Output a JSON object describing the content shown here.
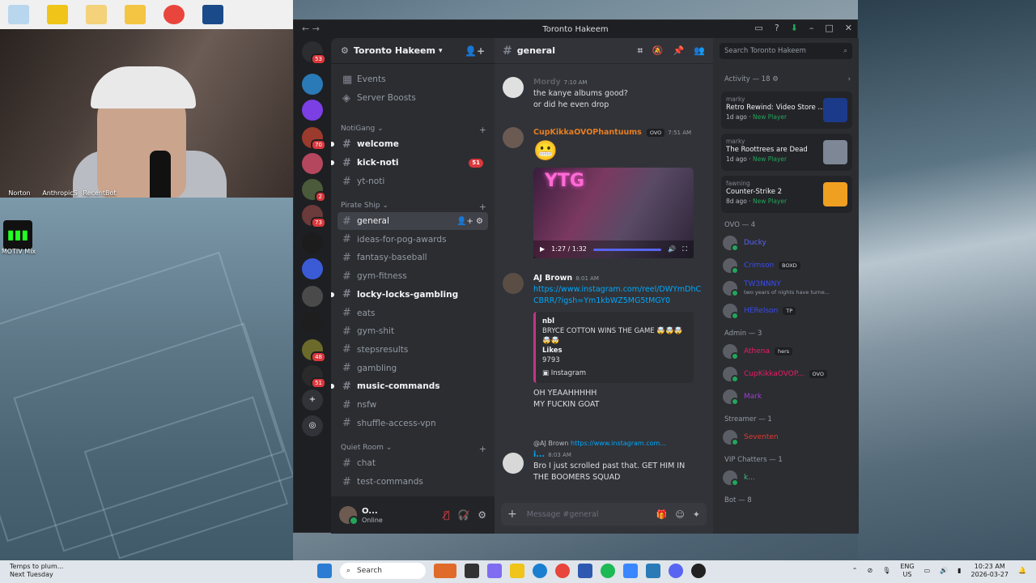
{
  "desktop": {
    "icon_labels": [
      "Norton AntiVirus",
      "AnthropicS",
      "RecentBot Desktop",
      "MOTIV Mix"
    ]
  },
  "window": {
    "title": "Toronto Hakeem",
    "server_name": "Toronto Hakeem"
  },
  "servers": [
    {
      "badge": "53"
    },
    {
      "badge": ""
    },
    {
      "badge": ""
    },
    {
      "badge": "70"
    },
    {
      "badge": ""
    },
    {
      "badge": "2"
    },
    {
      "badge": "73"
    },
    {
      "badge": ""
    },
    {
      "badge": ""
    },
    {
      "badge": ""
    },
    {
      "badge": ""
    },
    {
      "badge": "48"
    },
    {
      "badge": "51"
    }
  ],
  "sidebar": {
    "top_items": [
      "Events",
      "Server Boosts"
    ],
    "categories": [
      {
        "name": "NotiGang",
        "channels": [
          {
            "name": "welcome",
            "unread": true,
            "count": ""
          },
          {
            "name": "kick-noti",
            "unread": true,
            "count": "51"
          },
          {
            "name": "yt-noti",
            "unread": false,
            "count": ""
          }
        ]
      },
      {
        "name": "Pirate Ship",
        "channels": [
          {
            "name": "general",
            "active": true
          },
          {
            "name": "ideas-for-pog-awards"
          },
          {
            "name": "fantasy-baseball"
          },
          {
            "name": "gym-fitness"
          },
          {
            "name": "locky-locks-gambling",
            "unread": true
          },
          {
            "name": "eats"
          },
          {
            "name": "gym-shit"
          },
          {
            "name": "stepsresults"
          },
          {
            "name": "gambling"
          },
          {
            "name": "music-commands",
            "unread": true
          },
          {
            "name": "nsfw"
          },
          {
            "name": "shuffle-access-vpn"
          }
        ]
      },
      {
        "name": "Quiet Room",
        "channels": [
          {
            "name": "chat"
          },
          {
            "name": "test-commands"
          }
        ]
      }
    ],
    "user": {
      "name": "O...",
      "status": "Online"
    }
  },
  "chat": {
    "channel": "general",
    "messages": [
      {
        "author": "Mordy",
        "time": "7:10 AM",
        "lines": [
          "the kanye albums good?",
          "or did he even drop"
        ]
      },
      {
        "author": "CupKikkaOVOPhantuums",
        "tag": "OVO",
        "time": "7:51 AM",
        "emoji": "😬",
        "video_text": "YTG",
        "video_time": "1:27 / 1:32"
      },
      {
        "author": "AJ Brown",
        "time": "8:01 AM",
        "link": "https://www.instagram.com/reel/DWYmDhCCBRR/?igsh=Ym1kbWZ5MG5tMGY0",
        "embed": {
          "author": "nbl",
          "text": "BRYCE COTTON WINS THE GAME 🤯🤯🤯🤯🤯",
          "likes_label": "Likes",
          "likes": "9793",
          "footer": "Instagram"
        },
        "lines": [
          "OH YEAAHHHHH",
          "MY FUCKIN GOAT"
        ]
      },
      {
        "reply_to": "@AJ Brown",
        "reply_link": "https://www.instagram.com...",
        "author": "i...",
        "time": "8:03 AM",
        "lines": [
          "Bro I just scrolled past that. GET HIM IN",
          "THE BOOMERS SQUAD"
        ]
      }
    ],
    "composer_placeholder": "Message #general"
  },
  "members": {
    "search_placeholder": "Search Toronto Hakeem",
    "activity_header": "Activity — 18",
    "activities": [
      {
        "user": "marky",
        "title": "Retro Rewind: Video Store ...",
        "meta": "1d ago",
        "tag": "New Player",
        "thumb_color": "#1b3a8a"
      },
      {
        "user": "marky",
        "title": "The Roottrees are Dead",
        "meta": "1d ago",
        "tag": "New Player",
        "thumb_color": "#7d8796"
      },
      {
        "user": "fawning",
        "title": "Counter-Strike 2",
        "meta": "8d ago",
        "tag": "New Player",
        "thumb_color": "#f0a020"
      }
    ],
    "groups": [
      {
        "label": "OVO — 4",
        "members": [
          {
            "name": "Ducky",
            "color": "#5865f2",
            "tag": ""
          },
          {
            "name": "Crimson",
            "color": "#3b4bf2",
            "tag": "BOXD"
          },
          {
            "name": "TW3NNNY",
            "color": "#3b4bf2",
            "tag": "",
            "sub": "two years of nights have turne..."
          },
          {
            "name": "HERelson",
            "color": "#3b4bf2",
            "tag": "TP"
          }
        ]
      },
      {
        "label": "Admin — 3",
        "members": [
          {
            "name": "Athena",
            "color": "#e91e63",
            "tag": "hers"
          },
          {
            "name": "CupKikkaOVOP...",
            "color": "#e91e63",
            "tag": "OVO"
          },
          {
            "name": "Mark",
            "color": "#a23bd6",
            "tag": ""
          }
        ]
      },
      {
        "label": "Streamer — 1",
        "members": [
          {
            "name": "Seventen",
            "color": "#e53935",
            "tag": ""
          }
        ]
      },
      {
        "label": "VIP Chatters — 1",
        "members": [
          {
            "name": "k...",
            "color": "#43b581",
            "tag": ""
          }
        ]
      },
      {
        "label": "Bot — 8",
        "members": []
      }
    ]
  },
  "taskbar": {
    "weather_title": "Temps to plum...",
    "weather_sub": "Next Tuesday",
    "search_label": "Search",
    "lang": "ENG",
    "region": "US",
    "time": "10:23 AM",
    "date": "2026-03-27"
  }
}
